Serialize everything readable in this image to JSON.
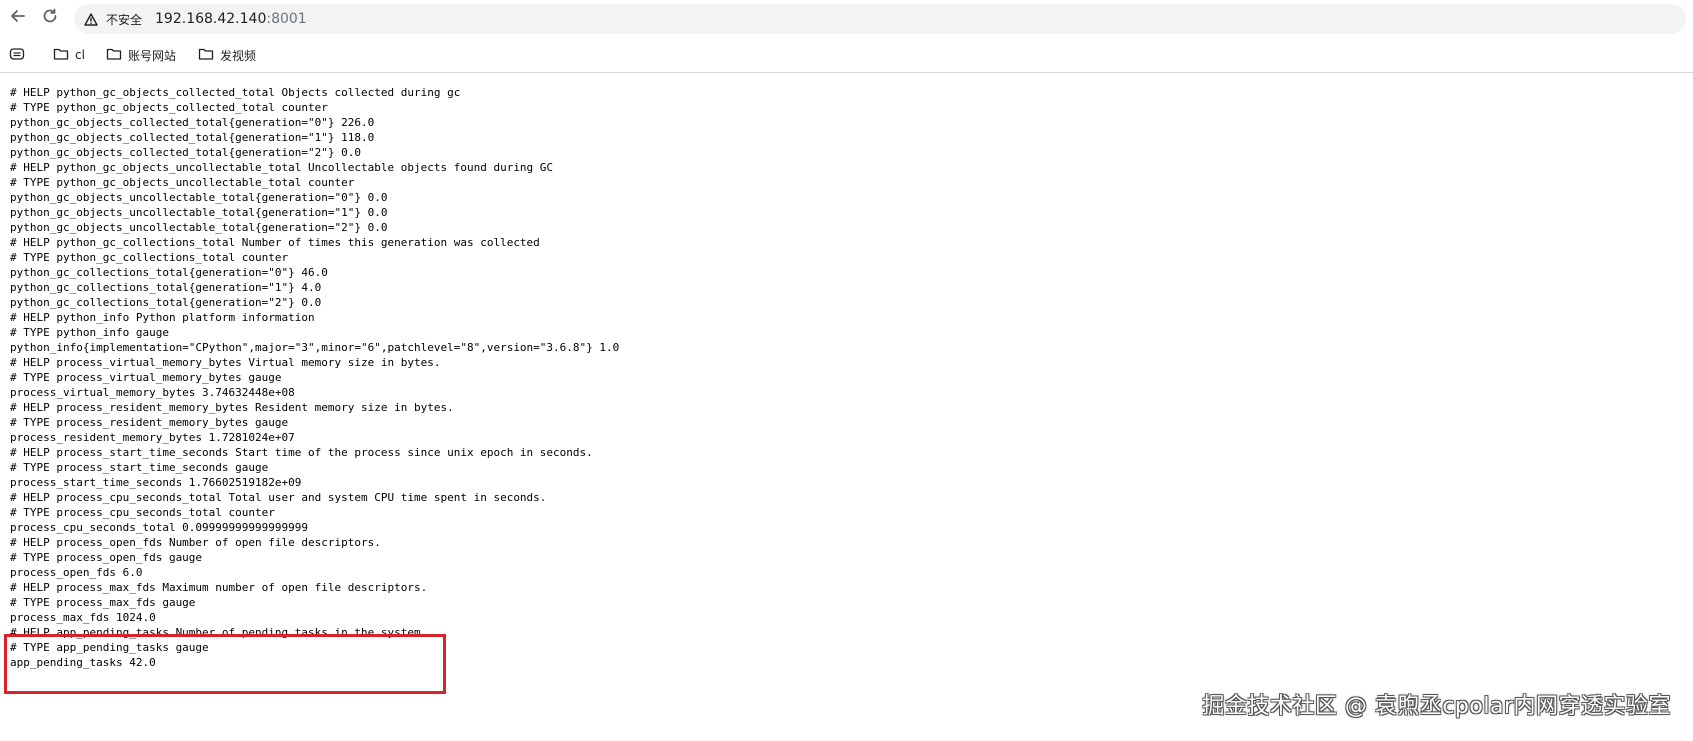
{
  "browser": {
    "address": {
      "insecure_label": "不安全",
      "host": "192.168.42.140",
      "port": ":8001"
    },
    "bookmarks": [
      {
        "label": "cl",
        "icon": "folder-icon"
      },
      {
        "label": "账号网站",
        "icon": "folder-icon"
      },
      {
        "label": "发视频",
        "icon": "folder-icon"
      }
    ],
    "icons": {
      "back": "back-arrow-icon",
      "reload": "reload-icon",
      "warning": "warning-triangle-icon",
      "apps": "apps-icon"
    }
  },
  "metrics_lines": [
    "# HELP python_gc_objects_collected_total Objects collected during gc",
    "# TYPE python_gc_objects_collected_total counter",
    "python_gc_objects_collected_total{generation=\"0\"} 226.0",
    "python_gc_objects_collected_total{generation=\"1\"} 118.0",
    "python_gc_objects_collected_total{generation=\"2\"} 0.0",
    "# HELP python_gc_objects_uncollectable_total Uncollectable objects found during GC",
    "# TYPE python_gc_objects_uncollectable_total counter",
    "python_gc_objects_uncollectable_total{generation=\"0\"} 0.0",
    "python_gc_objects_uncollectable_total{generation=\"1\"} 0.0",
    "python_gc_objects_uncollectable_total{generation=\"2\"} 0.0",
    "# HELP python_gc_collections_total Number of times this generation was collected",
    "# TYPE python_gc_collections_total counter",
    "python_gc_collections_total{generation=\"0\"} 46.0",
    "python_gc_collections_total{generation=\"1\"} 4.0",
    "python_gc_collections_total{generation=\"2\"} 0.0",
    "# HELP python_info Python platform information",
    "# TYPE python_info gauge",
    "python_info{implementation=\"CPython\",major=\"3\",minor=\"6\",patchlevel=\"8\",version=\"3.6.8\"} 1.0",
    "# HELP process_virtual_memory_bytes Virtual memory size in bytes.",
    "# TYPE process_virtual_memory_bytes gauge",
    "process_virtual_memory_bytes 3.74632448e+08",
    "# HELP process_resident_memory_bytes Resident memory size in bytes.",
    "# TYPE process_resident_memory_bytes gauge",
    "process_resident_memory_bytes 1.7281024e+07",
    "# HELP process_start_time_seconds Start time of the process since unix epoch in seconds.",
    "# TYPE process_start_time_seconds gauge",
    "process_start_time_seconds 1.76602519182e+09",
    "# HELP process_cpu_seconds_total Total user and system CPU time spent in seconds.",
    "# TYPE process_cpu_seconds_total counter",
    "process_cpu_seconds_total 0.09999999999999999",
    "# HELP process_open_fds Number of open file descriptors.",
    "# TYPE process_open_fds gauge",
    "process_open_fds 6.0",
    "# HELP process_max_fds Maximum number of open file descriptors.",
    "# TYPE process_max_fds gauge",
    "process_max_fds 1024.0",
    "# HELP app_pending_tasks Number of pending tasks in the system.",
    "# TYPE app_pending_tasks gauge",
    "app_pending_tasks 42.0"
  ],
  "annotation": {
    "color": "#d9232c"
  },
  "watermark": "掘金技术社区 @ 袁煦丞cpolar内网穿透实验室"
}
